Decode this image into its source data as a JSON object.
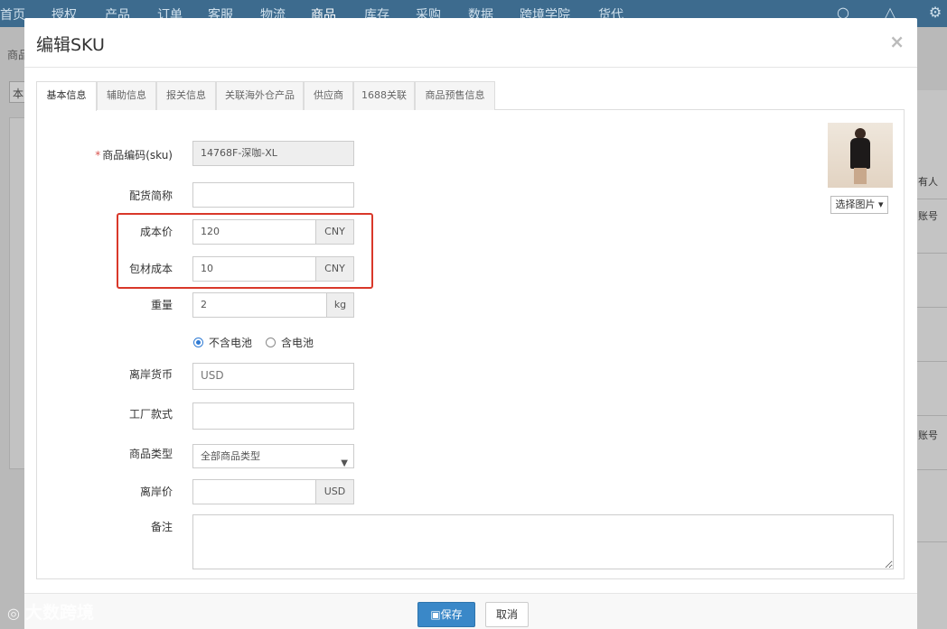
{
  "app": {
    "nav": [
      "首页",
      "授权",
      "产品",
      "订单",
      "客服",
      "物流",
      "商品",
      "库存",
      "采购",
      "数据",
      "跨境学院",
      "货代"
    ],
    "active_nav": "商品",
    "crumb": "商品",
    "bg_tab": "本",
    "right_texts": [
      "有人",
      "账号",
      "账号"
    ]
  },
  "modal": {
    "title": "编辑SKU",
    "close": "×",
    "tabs": [
      "基本信息",
      "辅助信息",
      "报关信息",
      "关联海外仓产品",
      "供应商",
      "1688关联",
      "商品预售信息"
    ],
    "form": {
      "sku_label": "商品编码(sku)",
      "sku_required": "*",
      "sku_value": "14768F-深咖-XL",
      "alias_label": "配货简称",
      "alias_value": "",
      "cost_label": "成本价",
      "cost_value": "120",
      "cost_unit": "CNY",
      "pack_label": "包材成本",
      "pack_value": "10",
      "pack_unit": "CNY",
      "weight_label": "重量",
      "weight_value": "2",
      "weight_unit": "kg",
      "battery_options": [
        "不含电池",
        "含电池"
      ],
      "battery_selected": "不含电池",
      "currency_label": "离岸货币",
      "currency_value": "USD",
      "factory_label": "工厂款式",
      "factory_value": "",
      "type_label": "商品类型",
      "type_value": "全部商品类型",
      "fob_label": "离岸价",
      "fob_value": "",
      "fob_unit": "USD",
      "notes_label": "备注",
      "notes_value": ""
    },
    "image_button": "选择图片",
    "save_label": "保存",
    "cancel_label": "取消"
  },
  "watermark": "大数跨境"
}
